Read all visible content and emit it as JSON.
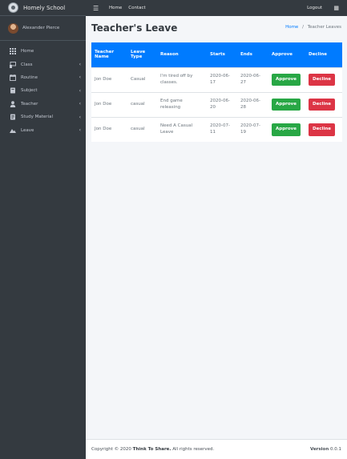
{
  "brand": {
    "name": "Homely School"
  },
  "user": {
    "name": "Alexander Pierce"
  },
  "sidebar": {
    "items": [
      {
        "label": "Home",
        "icon": "home-icon",
        "chevron": false
      },
      {
        "label": "Class",
        "icon": "class-icon",
        "chevron": true
      },
      {
        "label": "Routine",
        "icon": "routine-icon",
        "chevron": true
      },
      {
        "label": "Subject",
        "icon": "subject-icon",
        "chevron": true
      },
      {
        "label": "Teacher",
        "icon": "teacher-icon",
        "chevron": true
      },
      {
        "label": "Study Material",
        "icon": "study-material-icon",
        "chevron": true
      },
      {
        "label": "Leave",
        "icon": "leave-icon",
        "chevron": true
      }
    ]
  },
  "topnav": {
    "home": "Home",
    "contact": "Contact",
    "logout": "Logout"
  },
  "page": {
    "title": "Teacher's Leave",
    "breadcrumb": {
      "home": "Home",
      "separator": "/",
      "current": "Teacher Leaves"
    }
  },
  "table": {
    "headers": {
      "teacher_name": "Teacher Name",
      "leave_type": "Leave Type",
      "reason": "Reason",
      "starts": "Starts",
      "ends": "Ends",
      "approve": "Approve",
      "decline": "Decline"
    },
    "rows": [
      {
        "teacher": "Jon Doe",
        "type": "Casual",
        "reason": "I'm tired off by classes.",
        "starts": "2020-06-17",
        "ends": "2020-06-27",
        "approve": "Approve",
        "decline": "Decline"
      },
      {
        "teacher": "Jon Doe",
        "type": "casual",
        "reason": "End game releasing",
        "starts": "2020-06-20",
        "ends": "2020-06-28",
        "approve": "Approve",
        "decline": "Decline"
      },
      {
        "teacher": "Jon Doe",
        "type": "casual",
        "reason": "Need A Casual Leave",
        "starts": "2020-07-11",
        "ends": "2020-07-19",
        "approve": "Approve",
        "decline": "Decline"
      }
    ]
  },
  "footer": {
    "copyright_prefix": "Copyright © 2020",
    "company": "Think To Share.",
    "rights": "All rights reserved.",
    "version_label": "Version",
    "version": "0.0.1"
  },
  "colors": {
    "sidebar_bg": "#343a40",
    "header_blue": "#007bff",
    "approve_green": "#28a745",
    "decline_red": "#dc3545",
    "content_bg": "#f4f6f9"
  }
}
